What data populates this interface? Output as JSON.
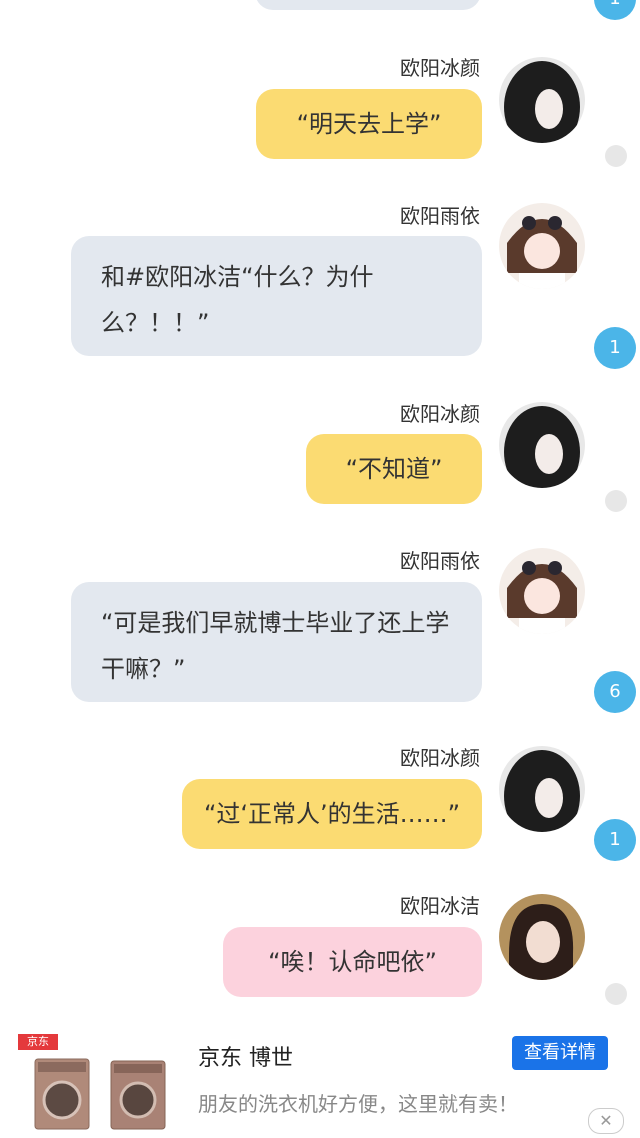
{
  "messages": [
    {
      "sender": "欧阳冰颜",
      "text": "“明天去上学”"
    },
    {
      "sender": "欧阳雨依",
      "text": "和#欧阳冰洁“什么？为什么？！！”"
    },
    {
      "sender": "欧阳冰颜",
      "text": "“不知道”"
    },
    {
      "sender": "欧阳雨依",
      "text": "“可是我们早就博士毕业了还上学干嘛？”"
    },
    {
      "sender": "欧阳冰颜",
      "text": "“过‘正常人’的生活……”"
    },
    {
      "sender": "欧阳冰洁",
      "text": "“唉！认命吧依”"
    }
  ],
  "badges": [
    "1",
    "1",
    "6",
    "1"
  ],
  "ad": {
    "logo_text": "京东",
    "title": "京东 博世",
    "description": "朋友的洗衣机好方便，这里就有卖！",
    "cta": "查看详情",
    "close_icon": "close-icon"
  },
  "colors": {
    "bubble_yellow": "#fbdb72",
    "bubble_blue": "#e3e8ef",
    "bubble_pink": "#fcd2dd",
    "badge": "#4bb5e8",
    "cta": "#1a73e8"
  }
}
